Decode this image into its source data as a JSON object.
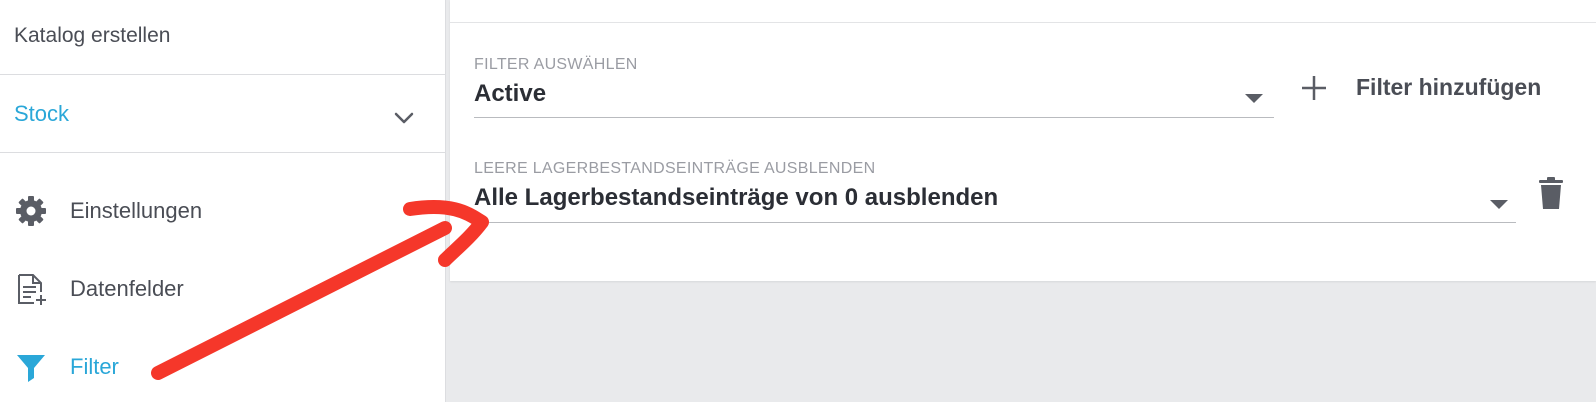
{
  "sidebar": {
    "title": "Katalog erstellen",
    "catalog_select": {
      "value": "Stock"
    },
    "items": [
      {
        "label": "Einstellungen",
        "icon": "gear-icon"
      },
      {
        "label": "Datenfelder",
        "icon": "document-add-icon"
      },
      {
        "label": "Filter",
        "icon": "funnel-icon",
        "active": true
      }
    ]
  },
  "main": {
    "filter_select": {
      "label": "FILTER AUSWÄHLEN",
      "value": "Active"
    },
    "add_filter_label": "Filter hinzufügen",
    "empty_stock_select": {
      "label": "LEERE LAGERBESTANDSEINTRÄGE AUSBLENDEN",
      "value": "Alle Lagerbestandseinträge von 0 ausblenden"
    }
  },
  "colors": {
    "accent": "#2aa7d8",
    "annotation_arrow": "#f5372a",
    "background": "#e9eaec"
  }
}
